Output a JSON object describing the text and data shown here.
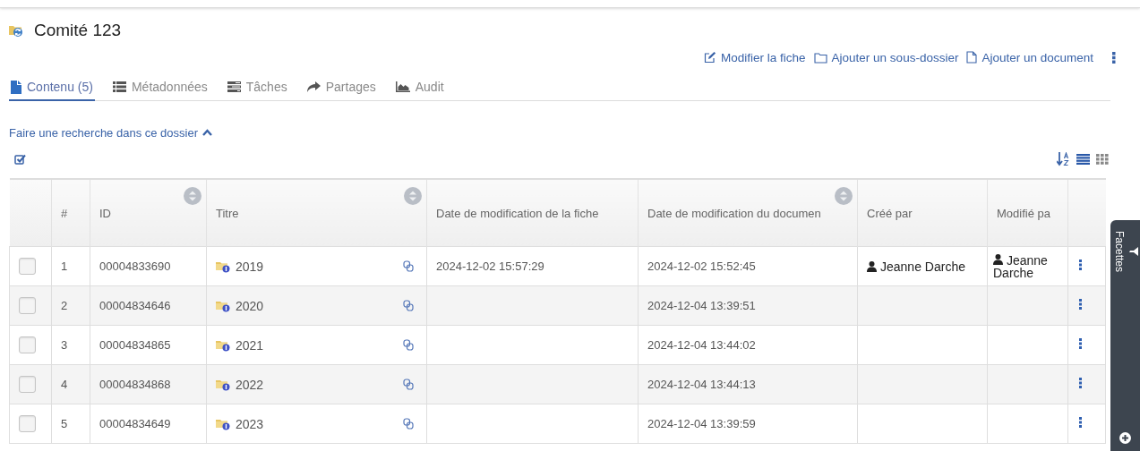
{
  "header": {
    "title": "Comité 123"
  },
  "actions": [
    {
      "kind": "edit",
      "label": "Modifier la fiche"
    },
    {
      "kind": "folder",
      "label": "Ajouter un sous-dossier"
    },
    {
      "kind": "document",
      "label": "Ajouter un document"
    }
  ],
  "tabs": [
    {
      "kind": "file",
      "label": "Contenu (5)",
      "selected": true
    },
    {
      "kind": "list",
      "label": "Métadonnées",
      "selected": false
    },
    {
      "kind": "tasks",
      "label": "Tâches",
      "selected": false
    },
    {
      "kind": "share",
      "label": "Partages",
      "selected": false
    },
    {
      "kind": "chart",
      "label": "Audit",
      "selected": false
    }
  ],
  "search_toggle": {
    "label": "Faire une recherche dans ce dossier",
    "expanded": true
  },
  "view_modes": [
    {
      "kind": "list",
      "selected": true
    },
    {
      "kind": "grid",
      "selected": false
    }
  ],
  "table": {
    "columns": [
      {
        "label": "#",
        "sortable": false
      },
      {
        "label": "ID",
        "sortable": true
      },
      {
        "label": "Titre",
        "sortable": true
      },
      {
        "label": "Date de modification de la fiche",
        "sortable": false
      },
      {
        "label": "Date de modification du documen",
        "sortable": true
      },
      {
        "label": "Créé par",
        "sortable": false
      },
      {
        "label": "Modifié pa",
        "sortable": false
      }
    ],
    "rows": [
      {
        "checked": false,
        "number": "1",
        "id": "00004833690",
        "title": "2019",
        "record_date": "2024-12-02 15:57:29",
        "document_date": "2024-12-02 15:52:45",
        "created_by": "Jeanne Darche",
        "modified_by": "Jeanne Darche"
      },
      {
        "checked": false,
        "number": "2",
        "id": "00004834646",
        "title": "2020",
        "document_date": "2024-12-04 13:39:51"
      },
      {
        "checked": false,
        "number": "3",
        "id": "00004834865",
        "title": "2021",
        "document_date": "2024-12-04 13:44:02"
      },
      {
        "checked": false,
        "number": "4",
        "id": "00004834868",
        "title": "2022",
        "document_date": "2024-12-04 13:44:13"
      },
      {
        "checked": false,
        "number": "5",
        "id": "00004834649",
        "title": "2023",
        "document_date": "2024-12-04 13:39:59"
      }
    ]
  },
  "facets_panel": {
    "label": "Facettes"
  }
}
